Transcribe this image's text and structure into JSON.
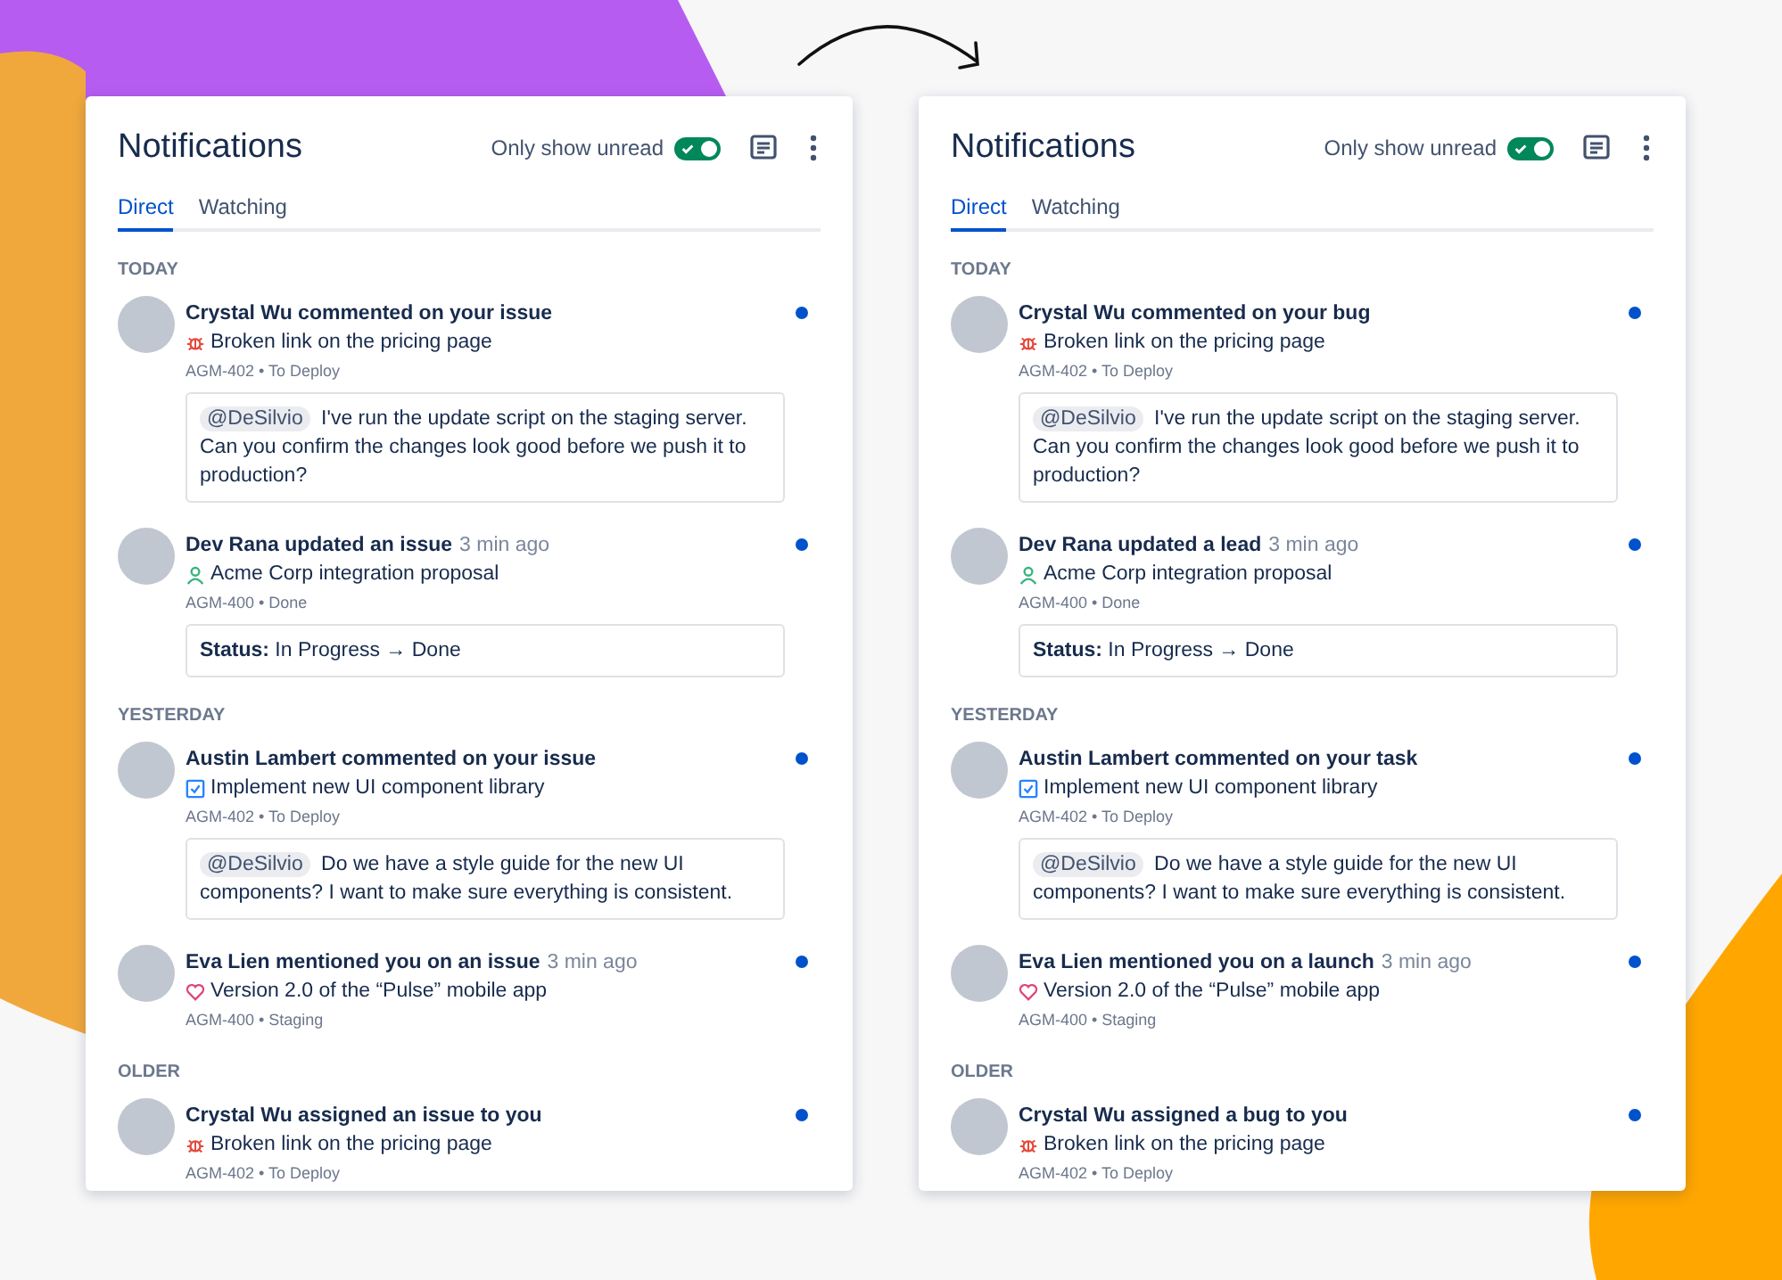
{
  "panels": [
    {
      "title": "Notifications",
      "toggle": {
        "label": "Only show unread",
        "on": true
      },
      "tabs": [
        {
          "label": "Direct",
          "selected": true
        },
        {
          "label": "Watching",
          "selected": false
        }
      ],
      "sections": [
        {
          "label": "TODAY",
          "items": [
            {
              "title": "Crystal Wu commented on your issue",
              "kind": "bug",
              "subject": "Broken link on the pricing page",
              "meta": "AGM-402 • To Deploy",
              "unread": true,
              "detail": {
                "kind": "comment",
                "mention": "@DeSilvio",
                "text": "I've run the update script on the staging server. Can you confirm the changes look good before we push it to production?"
              }
            },
            {
              "title": "Dev Rana updated an issue",
              "time": "3 min ago",
              "kind": "person",
              "subject": "Acme Corp integration proposal",
              "meta": "AGM-400 • Done",
              "unread": true,
              "detail": {
                "kind": "status",
                "text": "**Status:** In Progress → Done"
              }
            }
          ]
        },
        {
          "label": "YESTERDAY",
          "items": [
            {
              "title": "Austin Lambert commented on your issue",
              "kind": "task",
              "subject": "Implement new UI component library",
              "meta": "AGM-402 • To Deploy",
              "unread": true,
              "detail": {
                "kind": "comment",
                "mention": "@DeSilvio",
                "text": "Do we have a style guide for the new UI components? I want to make sure everything is consistent."
              }
            },
            {
              "title": "Eva Lien mentioned you on an issue",
              "time": "3 min ago",
              "kind": "heart",
              "subject": "Version 2.0 of the “Pulse” mobile app",
              "meta": "AGM-400 • Staging",
              "unread": true
            }
          ]
        },
        {
          "label": "OLDER",
          "items": [
            {
              "title": "Crystal Wu assigned an issue to you",
              "kind": "bug",
              "subject": "Broken link on the pricing page",
              "meta": "AGM-402 • To Deploy",
              "unread": true
            }
          ]
        }
      ]
    },
    {
      "title": "Notifications",
      "toggle": {
        "label": "Only show unread",
        "on": true
      },
      "tabs": [
        {
          "label": "Direct",
          "selected": true
        },
        {
          "label": "Watching",
          "selected": false
        }
      ],
      "sections": [
        {
          "label": "TODAY",
          "items": [
            {
              "title": "Crystal Wu commented on your bug",
              "kind": "bug",
              "subject": "Broken link on the pricing page",
              "meta": "AGM-402 • To Deploy",
              "unread": true,
              "detail": {
                "kind": "comment",
                "mention": "@DeSilvio",
                "text": "I've run the update script on the staging server. Can you confirm the changes look good before we push it to production?"
              }
            },
            {
              "title": "Dev Rana updated a lead",
              "time": "3 min ago",
              "kind": "person",
              "subject": "Acme Corp integration proposal",
              "meta": "AGM-400 • Done",
              "unread": true,
              "detail": {
                "kind": "status",
                "text": "**Status:** In Progress → Done"
              }
            }
          ]
        },
        {
          "label": "YESTERDAY",
          "items": [
            {
              "title": "Austin Lambert commented on your task",
              "kind": "task",
              "subject": "Implement new UI component library",
              "meta": "AGM-402 • To Deploy",
              "unread": true,
              "detail": {
                "kind": "comment",
                "mention": "@DeSilvio",
                "text": "Do we have a style guide for the new UI components? I want to make sure everything is consistent."
              }
            },
            {
              "title": "Eva Lien mentioned you on a launch",
              "time": "3 min ago",
              "kind": "heart",
              "subject": "Version 2.0 of the “Pulse” mobile app",
              "meta": "AGM-400 • Staging",
              "unread": true
            }
          ]
        },
        {
          "label": "OLDER",
          "items": [
            {
              "title": "Crystal Wu assigned a bug to you",
              "kind": "bug",
              "subject": "Broken link on the pricing page",
              "meta": "AGM-402 • To Deploy",
              "unread": true
            }
          ]
        }
      ]
    }
  ]
}
